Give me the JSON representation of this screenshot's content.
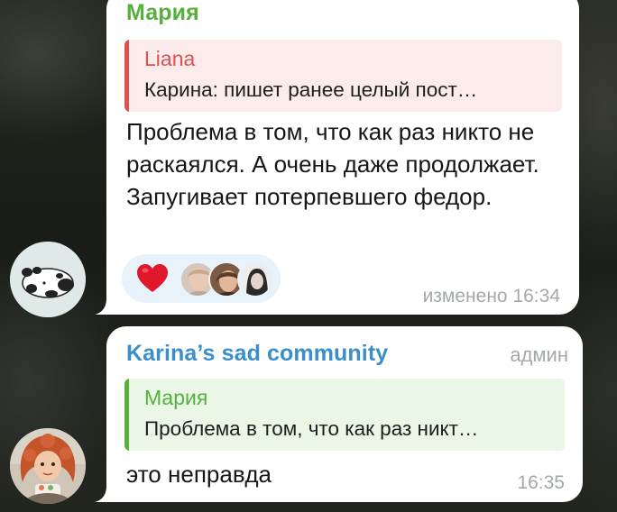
{
  "messages": [
    {
      "sender": "Мария",
      "sender_color": "#55b03c",
      "reply": {
        "name": "Liana",
        "text": "Карина: пишет ранее целый пост…",
        "accent": "#d9534f"
      },
      "text": "Проблема в том, что как раз никто не раскаялся. А очень даже продолжает. Запугивает потерпевшего федор.",
      "reactions": {
        "emoji": "heart-icon",
        "reactor_count": 3
      },
      "time": "изменено 16:34",
      "avatar": "panda-avatar"
    },
    {
      "sender": "Karina’s sad community",
      "sender_color": "#3a8fcb",
      "badge": "админ",
      "reply": {
        "name": "Мария",
        "text": "Проблема в том, что как раз никт…",
        "accent": "#55b03c"
      },
      "text": "это неправда",
      "time": "16:35",
      "avatar": "redhead-girl-avatar"
    }
  ]
}
